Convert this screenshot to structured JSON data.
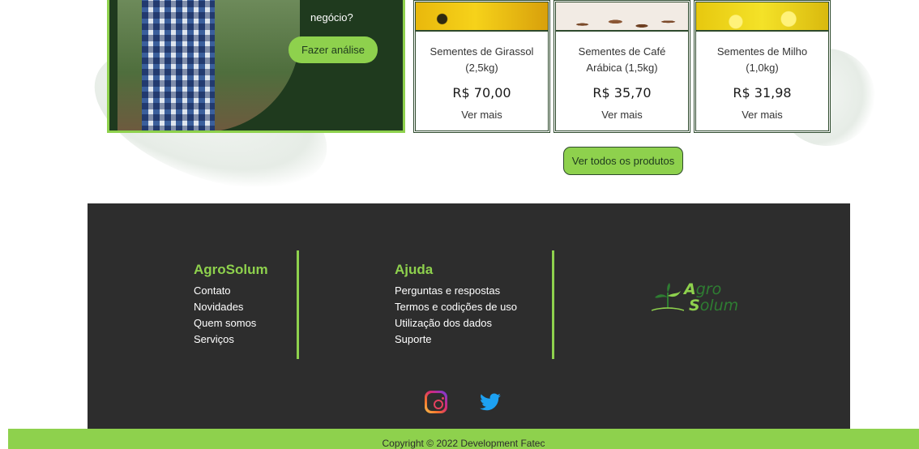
{
  "promo": {
    "question": "negócio?",
    "button_label": "Fazer análise"
  },
  "products": [
    {
      "name": "Sementes de Girassol (2,5kg)",
      "price": "R$ 70,00",
      "more": "Ver mais",
      "image": "sunflower-seeds"
    },
    {
      "name": "Sementes de Café Arábica (1,5kg)",
      "price": "R$ 35,70",
      "more": "Ver mais",
      "image": "coffee-beans"
    },
    {
      "name": "Sementes de Milho (1,0kg)",
      "price": "R$ 31,98",
      "more": "Ver mais",
      "image": "corn"
    }
  ],
  "all_products_label": "Ver todos os produtos",
  "footer": {
    "col1": {
      "title": "AgroSolum",
      "links": [
        "Contato",
        "Novidades",
        "Quem somos",
        "Serviços"
      ]
    },
    "col2": {
      "title": "Ajuda",
      "links": [
        "Perguntas e respostas",
        "Termos e codições de uso",
        "Utilização dos dados",
        "Suporte"
      ]
    },
    "logo": {
      "line1_initial": "A",
      "line1_rest": "gro",
      "line2_initial": "S",
      "line2_rest": "olum"
    },
    "social": [
      "instagram-icon",
      "twitter-icon"
    ]
  },
  "copyright": "Copyright © 2022 Development Fatec",
  "colors": {
    "accent": "#8ed14d",
    "dark_green": "#1f3a1e",
    "footer_bg": "#2d2d2d"
  }
}
